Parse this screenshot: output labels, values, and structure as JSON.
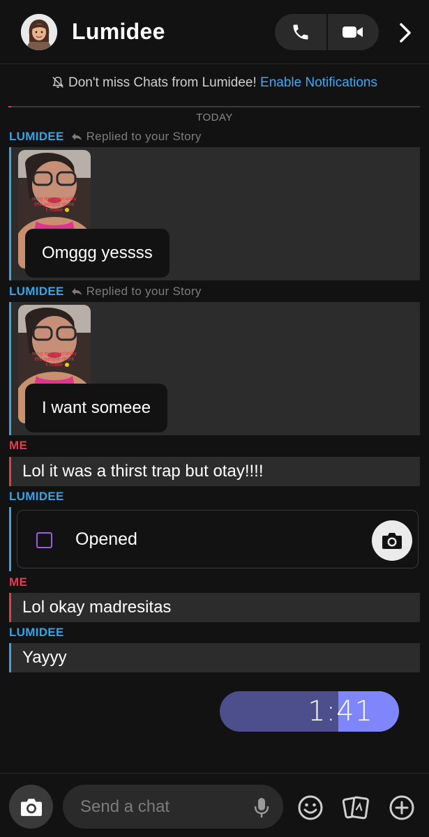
{
  "header": {
    "contact_name": "Lumidee",
    "icons": [
      "avatar",
      "phone-icon",
      "video-icon",
      "chevron-right-icon"
    ]
  },
  "notification": {
    "text": "Don't miss Chats from Lumidee!",
    "link": "Enable Notifications"
  },
  "date_divider": "TODAY",
  "messages": [
    {
      "sender": "LUMIDEE",
      "note": "Replied to your Story",
      "text": "Omggg yessss"
    },
    {
      "sender": "LUMIDEE",
      "note": "Replied to your Story",
      "text": "I want someee"
    },
    {
      "sender": "ME",
      "text": "Lol it was a thirst trap but otay!!!!"
    },
    {
      "sender": "LUMIDEE",
      "snap_status": "Opened"
    },
    {
      "sender": "ME",
      "text": "Lol okay madresitas"
    },
    {
      "sender": "LUMIDEE",
      "text": "Yayyy"
    }
  ],
  "voice_timer": {
    "time": "1:41",
    "progress": 0.34
  },
  "composer": {
    "placeholder": "Send a chat"
  },
  "colors": {
    "background": "#121212",
    "them": "#3ba2e3",
    "me": "#e8394d",
    "link": "#3fa9f5",
    "timer_base": "#4d4f8c",
    "timer_fill": "#7f86fb"
  }
}
